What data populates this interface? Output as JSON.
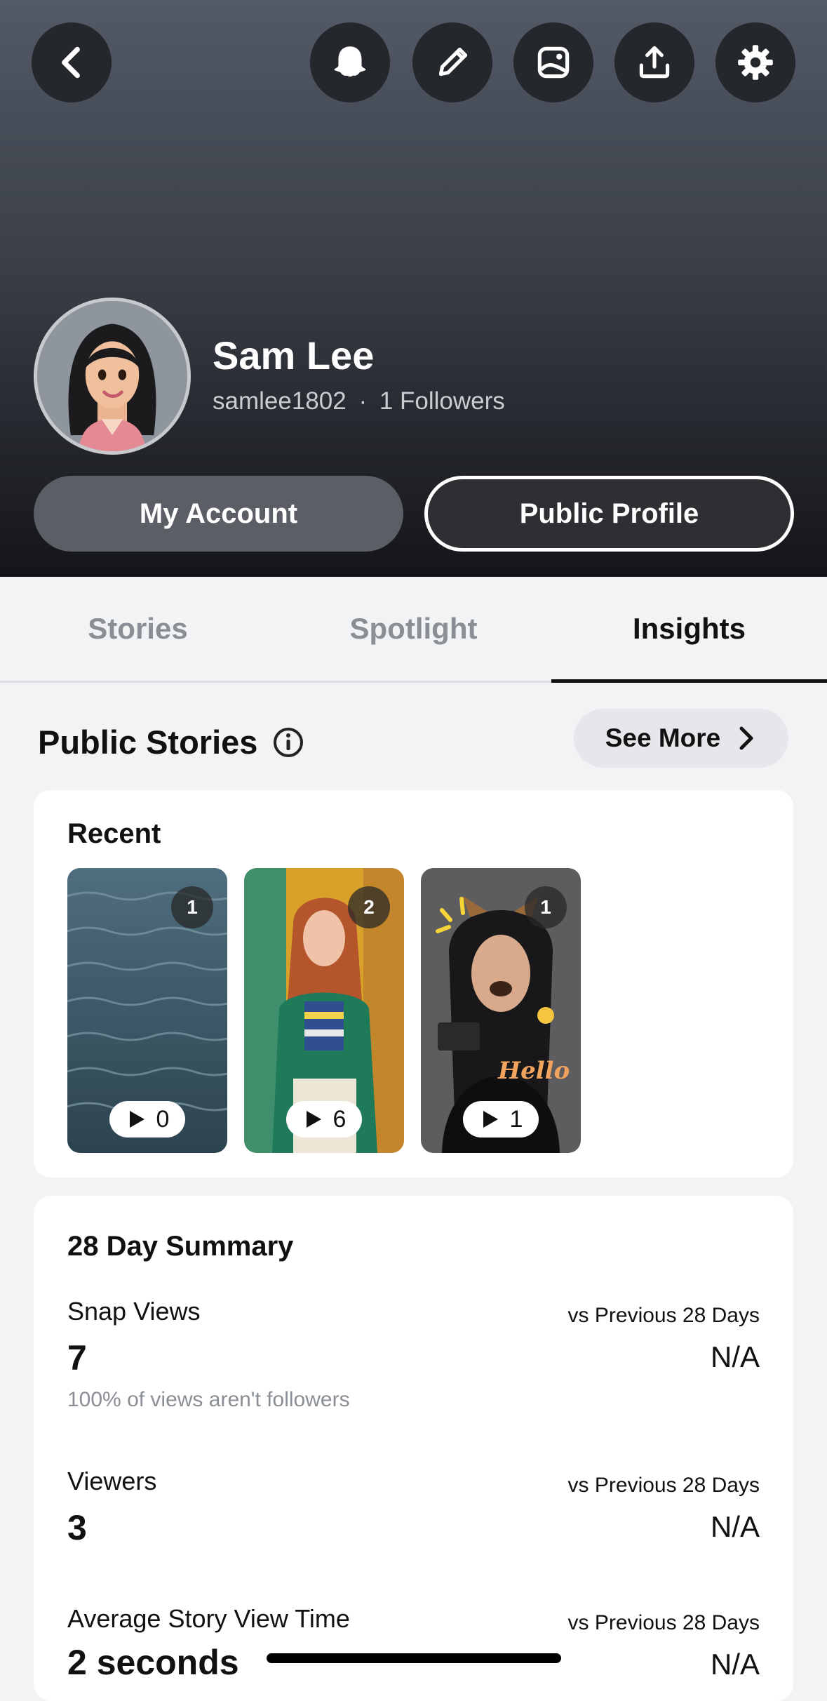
{
  "header": {
    "icons": {
      "back": "back-chevron-icon",
      "ghost": "ghost-icon",
      "edit": "pencil-icon",
      "image": "image-icon",
      "share": "upload-icon",
      "settings": "gear-icon"
    },
    "profile": {
      "name": "Sam Lee",
      "username": "samlee1802",
      "separator": "·",
      "followers": "1 Followers"
    },
    "buttons": {
      "account": "My Account",
      "public_profile": "Public Profile"
    }
  },
  "tabs": [
    {
      "label": "Stories",
      "active": false
    },
    {
      "label": "Spotlight",
      "active": false
    },
    {
      "label": "Insights",
      "active": true
    }
  ],
  "public_stories": {
    "title": "Public Stories",
    "see_more": "See More",
    "recent": {
      "title": "Recent",
      "items": [
        {
          "badge": "1",
          "views": "0",
          "scene": "ocean water"
        },
        {
          "badge": "2",
          "views": "6",
          "scene": "woman in green cardigan"
        },
        {
          "badge": "1",
          "views": "1",
          "scene": "selfie with dog lens"
        }
      ]
    }
  },
  "summary": {
    "title": "28 Day Summary",
    "stats": [
      {
        "label": "Snap Views",
        "value": "7",
        "note": "100% of views aren't followers",
        "compare_label": "vs Previous 28 Days",
        "compare_value": "N/A"
      },
      {
        "label": "Viewers",
        "value": "3",
        "note": "",
        "compare_label": "vs Previous 28 Days",
        "compare_value": "N/A"
      },
      {
        "label": "Average Story View Time",
        "value": "2 seconds",
        "note": "",
        "compare_label": "vs Previous 28 Days",
        "compare_value": "N/A"
      }
    ]
  },
  "colors": {
    "header_top": "#535a66",
    "header_bottom": "#141518",
    "icon_bg": "#24272c",
    "page_bg": "#f2f3f5"
  }
}
